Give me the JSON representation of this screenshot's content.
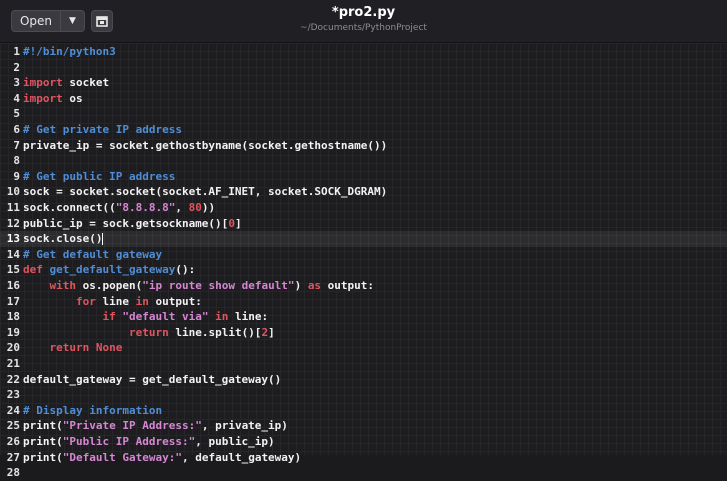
{
  "header": {
    "open_label": "Open",
    "title": "*pro2.py",
    "path": "~/Documents/PythonProject"
  },
  "icons": {
    "dropdown": "chevron-down-icon",
    "new_tab": "new-document-icon"
  },
  "colors": {
    "comment": "#4f8ed6",
    "keyword": "#e0555f",
    "string": "#d686d3",
    "number": "#e0555f",
    "text": "#f2f2f2",
    "background": "#1d1d20"
  },
  "editor": {
    "current_line": 13,
    "lines": [
      [
        {
          "t": "#!/bin/python3",
          "c": "t-cmt"
        }
      ],
      [],
      [
        {
          "t": "import",
          "c": "t-kw"
        },
        {
          "t": " socket"
        }
      ],
      [
        {
          "t": "import",
          "c": "t-kw"
        },
        {
          "t": " os"
        }
      ],
      [],
      [
        {
          "t": "# Get private IP address",
          "c": "t-cmt"
        }
      ],
      [
        {
          "t": "private_ip = socket.gethostbyname(socket.gethostname())"
        }
      ],
      [],
      [
        {
          "t": "# Get public IP address",
          "c": "t-cmt"
        }
      ],
      [
        {
          "t": "sock = socket.socket(socket.AF_INET, socket.SOCK_DGRAM)"
        }
      ],
      [
        {
          "t": "sock.connect(("
        },
        {
          "t": "\"8.8.8.8\"",
          "c": "t-str"
        },
        {
          "t": ", "
        },
        {
          "t": "80",
          "c": "t-num"
        },
        {
          "t": "))"
        }
      ],
      [
        {
          "t": "public_ip = sock.getsockname()["
        },
        {
          "t": "0",
          "c": "t-num"
        },
        {
          "t": "]"
        }
      ],
      [
        {
          "t": "sock.close()"
        }
      ],
      [
        {
          "t": "# Get default gateway",
          "c": "t-cmt"
        }
      ],
      [
        {
          "t": "def",
          "c": "t-kw"
        },
        {
          "t": " "
        },
        {
          "t": "get_default_gateway",
          "c": "t-fn"
        },
        {
          "t": "():"
        }
      ],
      [
        {
          "t": "    "
        },
        {
          "t": "with",
          "c": "t-kw"
        },
        {
          "t": " os.popen("
        },
        {
          "t": "\"ip route show default\"",
          "c": "t-str"
        },
        {
          "t": ") "
        },
        {
          "t": "as",
          "c": "t-kw"
        },
        {
          "t": " output:"
        }
      ],
      [
        {
          "t": "        "
        },
        {
          "t": "for",
          "c": "t-kw"
        },
        {
          "t": " line "
        },
        {
          "t": "in",
          "c": "t-kw"
        },
        {
          "t": " output:"
        }
      ],
      [
        {
          "t": "            "
        },
        {
          "t": "if",
          "c": "t-kw"
        },
        {
          "t": " "
        },
        {
          "t": "\"default via\"",
          "c": "t-str"
        },
        {
          "t": " "
        },
        {
          "t": "in",
          "c": "t-kw"
        },
        {
          "t": " line:"
        }
      ],
      [
        {
          "t": "                "
        },
        {
          "t": "return",
          "c": "t-kw"
        },
        {
          "t": " line.split()["
        },
        {
          "t": "2",
          "c": "t-num"
        },
        {
          "t": "]"
        }
      ],
      [
        {
          "t": "    "
        },
        {
          "t": "return",
          "c": "t-kw"
        },
        {
          "t": " "
        },
        {
          "t": "None",
          "c": "t-kw"
        }
      ],
      [],
      [
        {
          "t": "default_gateway = get_default_gateway()"
        }
      ],
      [],
      [
        {
          "t": "# Display information",
          "c": "t-cmt"
        }
      ],
      [
        {
          "t": "print("
        },
        {
          "t": "\"Private IP Address:\"",
          "c": "t-str"
        },
        {
          "t": ", private_ip)"
        }
      ],
      [
        {
          "t": "print("
        },
        {
          "t": "\"Public IP Address:\"",
          "c": "t-str"
        },
        {
          "t": ", public_ip)"
        }
      ],
      [
        {
          "t": "print("
        },
        {
          "t": "\"Default Gateway:\"",
          "c": "t-str"
        },
        {
          "t": ", default_gateway)"
        }
      ],
      []
    ]
  }
}
